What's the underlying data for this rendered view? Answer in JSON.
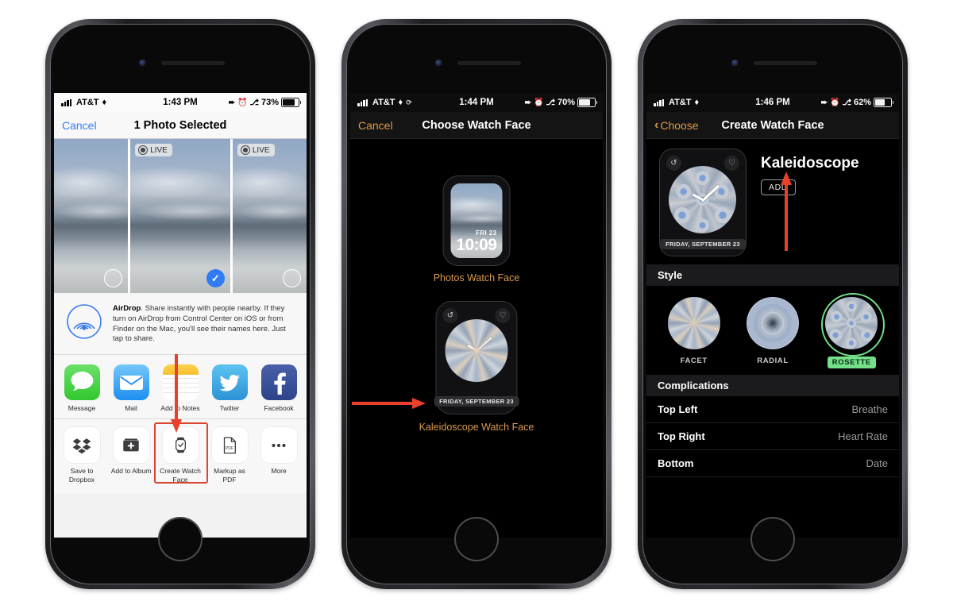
{
  "phones": [
    {
      "id": "photo-share-sheet",
      "status_bar": {
        "carrier": "AT&T",
        "time": "1:43 PM",
        "battery": "73%",
        "theme": "light"
      },
      "nav": {
        "left_label": "Cancel",
        "title": "1 Photo Selected"
      },
      "photo_grid": {
        "live_badge": "LIVE",
        "items": [
          {
            "selected": false,
            "live": false
          },
          {
            "selected": true,
            "live": true
          },
          {
            "selected": false,
            "live": true
          }
        ]
      },
      "airdrop": {
        "title": "AirDrop",
        "text": ". Share instantly with people nearby. If they turn on AirDrop from Control Center on iOS or from Finder on the Mac, you'll see their names here. Just tap to share."
      },
      "apps": [
        {
          "label": "Message",
          "icon": "message-icon"
        },
        {
          "label": "Mail",
          "icon": "mail-icon"
        },
        {
          "label": "Add to Notes",
          "icon": "notes-icon"
        },
        {
          "label": "Twitter",
          "icon": "twitter-icon"
        },
        {
          "label": "Facebook",
          "icon": "facebook-icon"
        }
      ],
      "actions": [
        {
          "label": "Save to Dropbox",
          "icon": "dropbox-icon",
          "highlighted": false
        },
        {
          "label": "Add to Album",
          "icon": "add-album-icon",
          "highlighted": false
        },
        {
          "label": "Create Watch Face",
          "icon": "watch-icon",
          "highlighted": true
        },
        {
          "label": "Markup as PDF",
          "icon": "pdf-icon",
          "highlighted": false
        },
        {
          "label": "More",
          "icon": "more-icon",
          "highlighted": false
        }
      ]
    },
    {
      "id": "choose-watch-face",
      "status_bar": {
        "carrier": "AT&T",
        "time": "1:44 PM",
        "battery": "70%",
        "theme": "dark"
      },
      "nav": {
        "left_label": "Cancel",
        "title": "Choose Watch Face"
      },
      "faces": [
        {
          "label": "Photos Watch Face",
          "face_date": "FRI 23",
          "face_time": "10:09"
        },
        {
          "label": "Kaleidoscope Watch Face",
          "face_date": "FRIDAY, SEPTEMBER 23"
        }
      ]
    },
    {
      "id": "create-watch-face",
      "status_bar": {
        "carrier": "AT&T",
        "time": "1:46 PM",
        "battery": "62%",
        "theme": "dark"
      },
      "nav": {
        "left_label": "Choose",
        "title": "Create Watch Face"
      },
      "preview": {
        "title": "Kaleidoscope",
        "add_label": "ADD",
        "face_date": "FRIDAY, SEPTEMBER 23"
      },
      "style_section": {
        "header": "Style",
        "options": [
          {
            "label": "FACET",
            "selected": false
          },
          {
            "label": "RADIAL",
            "selected": false
          },
          {
            "label": "ROSETTE",
            "selected": true
          }
        ]
      },
      "complications_section": {
        "header": "Complications",
        "rows": [
          {
            "name": "Top Left",
            "value": "Breathe"
          },
          {
            "name": "Top Right",
            "value": "Heart Rate"
          },
          {
            "name": "Bottom",
            "value": "Date"
          }
        ]
      }
    }
  ],
  "annotations": {
    "arrow_color": "#e8402a",
    "highlight_color": "#d9452f",
    "accent_blue": "#3a7bf0",
    "accent_amber": "#e09a46",
    "selection_green": "#74e08a"
  }
}
